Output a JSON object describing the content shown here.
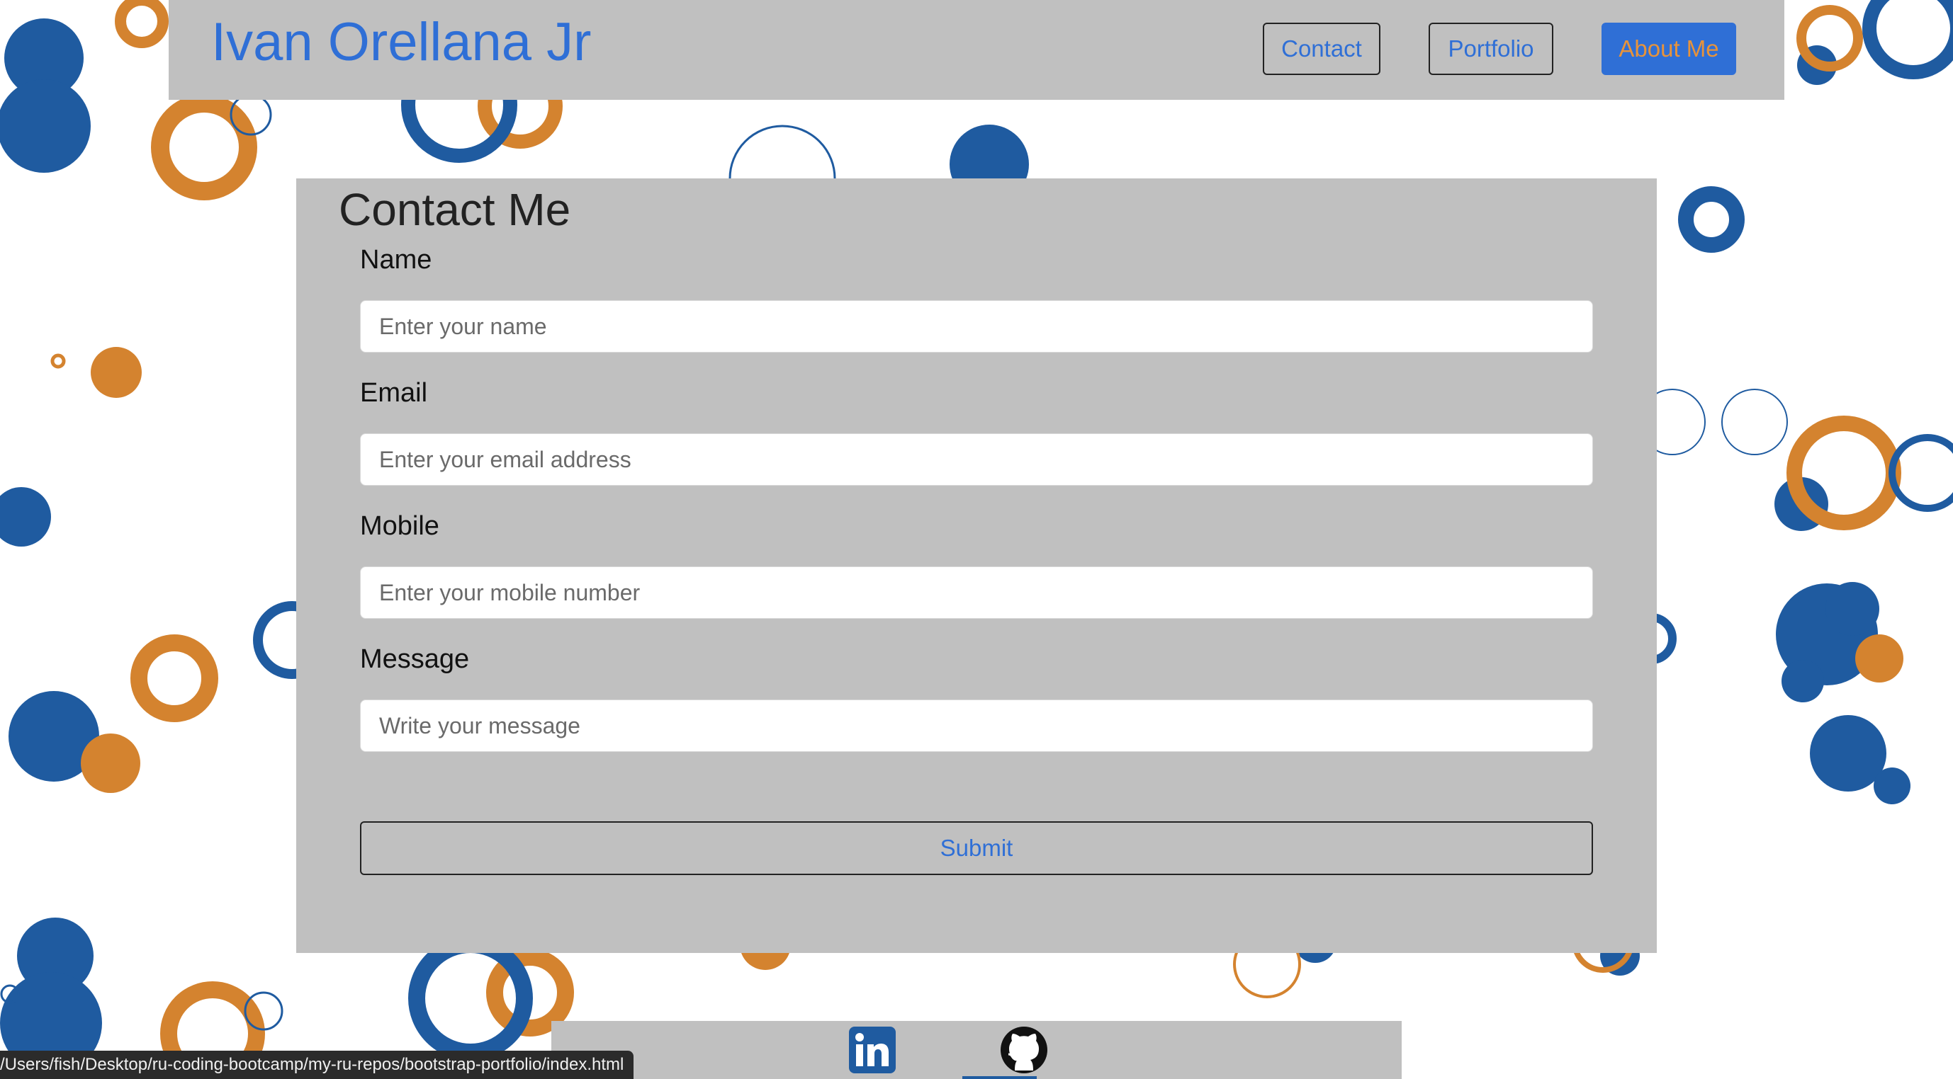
{
  "header": {
    "brand": "Ivan Orellana Jr",
    "nav": [
      {
        "label": "Contact"
      },
      {
        "label": "Portfolio"
      },
      {
        "label": "About Me"
      }
    ]
  },
  "contact_form": {
    "title": "Contact Me",
    "fields": [
      {
        "label": "Name",
        "placeholder": "Enter your name"
      },
      {
        "label": "Email",
        "placeholder": "Enter your email address"
      },
      {
        "label": "Mobile",
        "placeholder": "Enter your mobile number"
      },
      {
        "label": "Message",
        "placeholder": "Write your message"
      }
    ],
    "submit_label": "Submit"
  },
  "footer": {
    "links": [
      {
        "icon": "linkedin-icon"
      },
      {
        "icon": "github-icon"
      }
    ]
  },
  "status_bar": {
    "url": "/Users/fish/Desktop/ru-coding-bootcamp/my-ru-repos/bootstrap-portfolio/index.html"
  },
  "colors": {
    "accent_blue": "#2f6fd6",
    "panel_gray": "#c0c0c0",
    "bubble_blue": "#1f5ba0",
    "bubble_orange": "#d4832f"
  }
}
